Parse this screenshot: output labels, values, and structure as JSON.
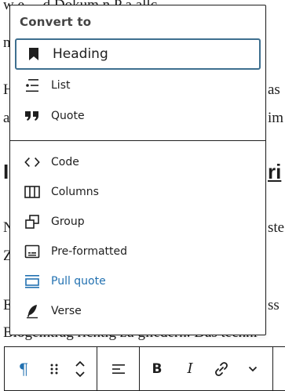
{
  "background_text": {
    "l1": "w e  ...  d  Dokum   n   P  a  allc",
    "l2": "n",
    "l3_left": "H",
    "l3_right": "as",
    "l4_left": "a",
    "l4_right": "im",
    "h1_left": "I",
    "h1_right": "ri",
    "l5_left": "N",
    "l5_right": "ste",
    "l6_left": "Z",
    "l7_left": "E",
    "l7_right": "ss",
    "l8": "Blogeintrag richtig zu gliedern. Das techni"
  },
  "popover": {
    "title": "Convert to",
    "items": [
      {
        "label": "Heading",
        "icon": "bookmark-icon"
      },
      {
        "label": "List",
        "icon": "list-icon"
      },
      {
        "label": "Quote",
        "icon": "quote-icon"
      },
      {
        "label": "Code",
        "icon": "code-icon"
      },
      {
        "label": "Columns",
        "icon": "columns-icon"
      },
      {
        "label": "Group",
        "icon": "group-icon"
      },
      {
        "label": "Pre-formatted",
        "icon": "preformatted-icon"
      },
      {
        "label": "Pull quote",
        "icon": "pullquote-icon"
      },
      {
        "label": "Verse",
        "icon": "verse-icon"
      }
    ],
    "accent_color": "#2271b1",
    "selected_border_color": "#3e6f8f"
  },
  "toolbar": {
    "paragraph_glyph": "¶",
    "bold_label": "B",
    "italic_label": "I"
  }
}
